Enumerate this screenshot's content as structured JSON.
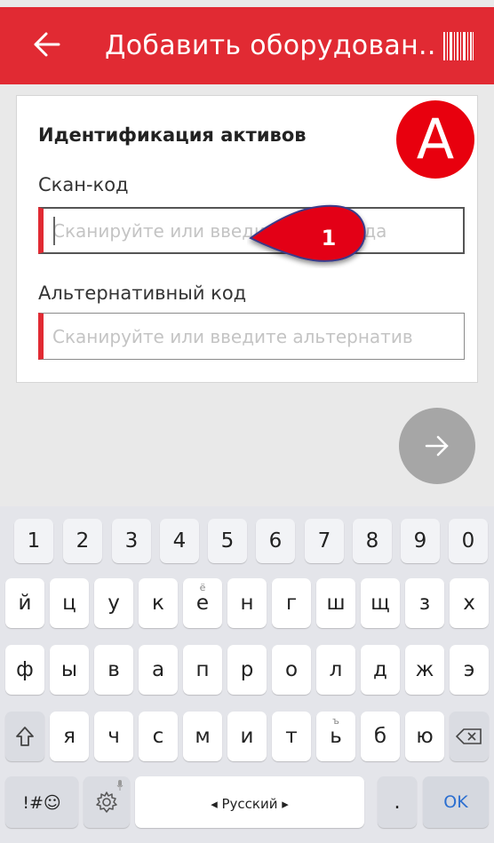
{
  "appbar": {
    "title": "Добавить оборудован...",
    "back_icon": "arrow-left-icon",
    "barcode_icon": "barcode-icon"
  },
  "card": {
    "title": "Идентификация активов",
    "scan_code": {
      "label": "Скан-код",
      "placeholder": "Сканируйте или введите скан-кода"
    },
    "alt_code": {
      "label": "Альтернативный код",
      "placeholder": "Сканируйте или введите альтернатив"
    }
  },
  "annotations": {
    "badge": "A",
    "marker": "1"
  },
  "keyboard": {
    "row_numbers": [
      "1",
      "2",
      "3",
      "4",
      "5",
      "6",
      "7",
      "8",
      "9",
      "0"
    ],
    "row1": [
      "й",
      "ц",
      "у",
      "к",
      "е",
      "н",
      "г",
      "ш",
      "щ",
      "з",
      "х"
    ],
    "row1_hint_e": "ё",
    "row2": [
      "ф",
      "ы",
      "в",
      "а",
      "п",
      "р",
      "о",
      "л",
      "д",
      "ж",
      "э"
    ],
    "row3": [
      "я",
      "ч",
      "с",
      "м",
      "и",
      "т",
      "ь",
      "б",
      "ю"
    ],
    "row3_hint_soft": "ъ",
    "symbols_label": "!#☺",
    "space_label": "◂ Русский ▸",
    "period_label": ".",
    "ok_label": "OK"
  },
  "colors": {
    "brand_red": "#e12a33",
    "fab_gray": "#a6a6a6",
    "keyboard_bg": "#e4e5ea"
  }
}
